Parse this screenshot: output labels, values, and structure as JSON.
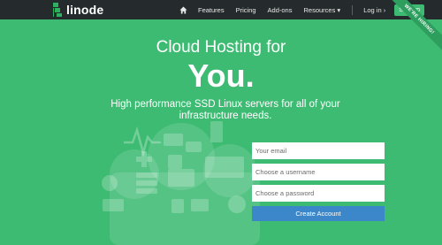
{
  "brand": {
    "name": "linode"
  },
  "nav": {
    "home_icon": "home-icon",
    "items": [
      "Features",
      "Pricing",
      "Add-ons",
      "Resources ▾"
    ],
    "login": "Log in ›",
    "signup": "Sign up"
  },
  "ribbon": "WE'RE HIRING!",
  "hero": {
    "line1": "Cloud Hosting for",
    "line2": "You.",
    "tagline": "High performance SSD Linux servers for all of your infrastructure needs."
  },
  "form": {
    "email_placeholder": "Your email",
    "username_placeholder": "Choose a username",
    "password_placeholder": "Choose a password",
    "submit_label": "Create Account"
  },
  "colors": {
    "background": "#3ebb73",
    "topbar": "#252b2d",
    "button": "#3b87c9",
    "ribbon": "#2d9e5d"
  },
  "decor_icons": [
    "cloud-icon",
    "pulse-icon",
    "chat-icon",
    "phone-icon",
    "plus-icon",
    "lock-icon",
    "lines-icon",
    "globe-icon",
    "envelope-icon",
    "server-icon",
    "code-icon",
    "video-icon",
    "gear-icon"
  ]
}
